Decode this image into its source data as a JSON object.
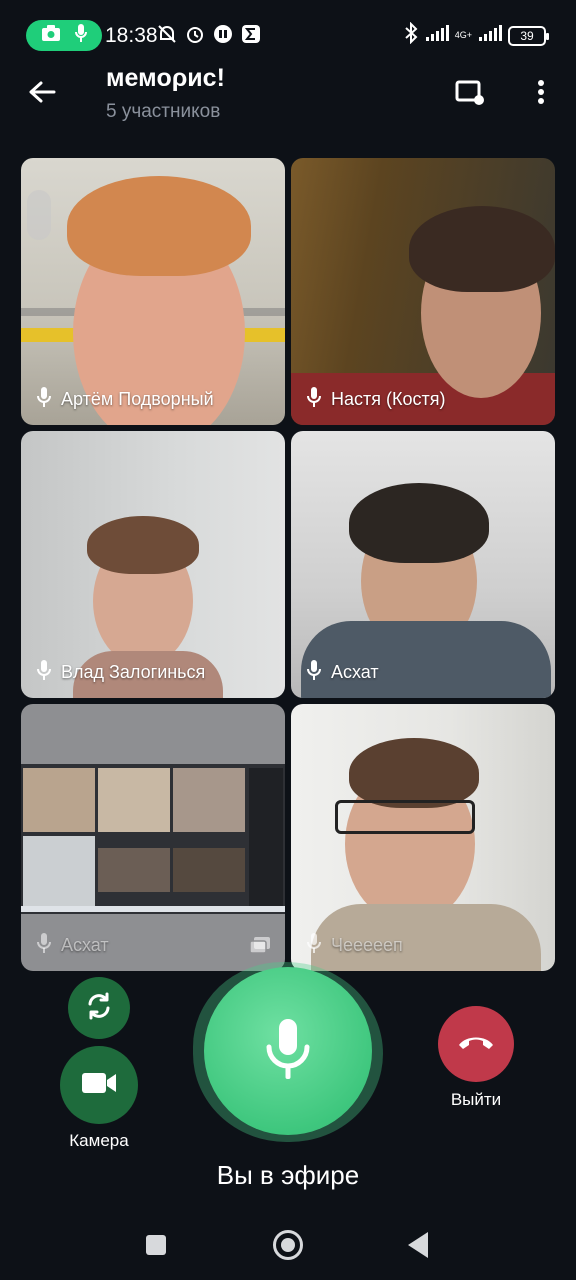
{
  "status_bar": {
    "time": "18:38",
    "network_label": "4G+",
    "battery": "39",
    "icons": [
      "camera-icon",
      "mic-icon",
      "bell-off-icon",
      "alarm-icon",
      "app-circle-icon",
      "sigma-icon",
      "bluetooth-icon",
      "signal-icon",
      "signal-icon",
      "battery-icon"
    ]
  },
  "header": {
    "title": "мемορис!",
    "subtitle": "5 участников"
  },
  "participants": [
    {
      "name": "Артём Подворный"
    },
    {
      "name": "Настя (Костя)"
    },
    {
      "name": "Влад Залогинься"
    },
    {
      "name": "Асхат"
    },
    {
      "name": "Асхат",
      "screen_share": true
    },
    {
      "name": "Чеееееп"
    }
  ],
  "controls": {
    "camera_label": "Камера",
    "leave_label": "Выйти",
    "status": "Вы в эфире"
  },
  "colors": {
    "background": "#0d1117",
    "accent_green": "#3fc77e",
    "leave_red": "#c0394a",
    "button_green": "#1e6b3c"
  }
}
